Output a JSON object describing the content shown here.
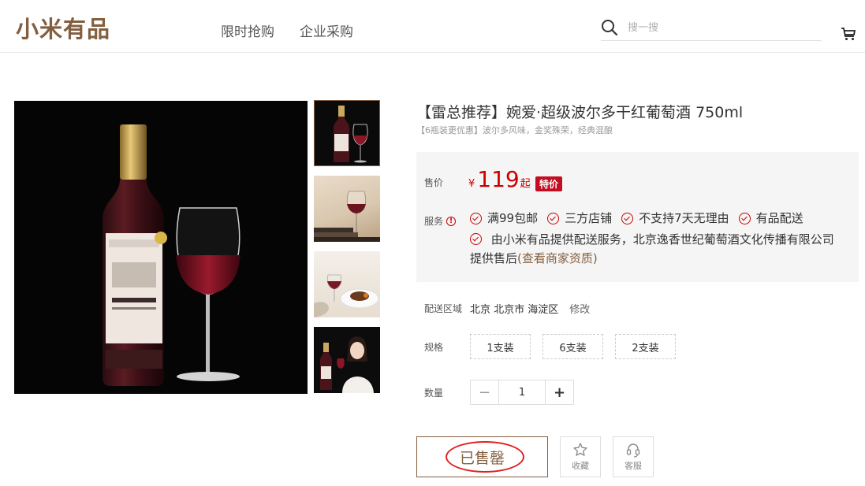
{
  "header": {
    "logo": "小米有品",
    "nav": [
      "限时抢购",
      "企业采购"
    ],
    "search_placeholder": "搜一搜"
  },
  "product": {
    "title": "【雷总推荐】婉爱·超级波尔多干红葡萄酒 750ml",
    "promo": "【6瓶装更优惠】",
    "subtitle": "波尔多风味，金奖殊荣，经典混酿",
    "price_label": "售价",
    "currency": "¥",
    "price": "119",
    "price_suffix": "起",
    "special_tag": "特价",
    "service_label": "服务",
    "services": [
      "满99包邮",
      "三方店铺",
      "不支持7天无理由",
      "有品配送"
    ],
    "service_long": "由小米有品提供配送服务，北京逸香世纪葡萄酒文化传播有限公司提供售后",
    "merchant_link": "(查看商家资质)",
    "delivery_label": "配送区域",
    "delivery_location": "北京 北京市 海淀区",
    "delivery_edit": "修改",
    "spec_label": "规格",
    "specs": [
      "1支装",
      "6支装",
      "2支装"
    ],
    "qty_label": "数量",
    "qty_minus": "−",
    "qty_value": "1",
    "qty_plus": "+",
    "soldout_label": "已售罄",
    "favorite_label": "收藏",
    "service_btn_label": "客服"
  },
  "colors": {
    "brand": "#845f3f",
    "price_red": "#cc0000",
    "tag_red": "#c30d23",
    "sold_circle": "#e02020"
  },
  "icons": [
    "search-icon",
    "cart-icon",
    "check-circle-icon",
    "warning-icon",
    "star-icon",
    "headset-icon"
  ]
}
